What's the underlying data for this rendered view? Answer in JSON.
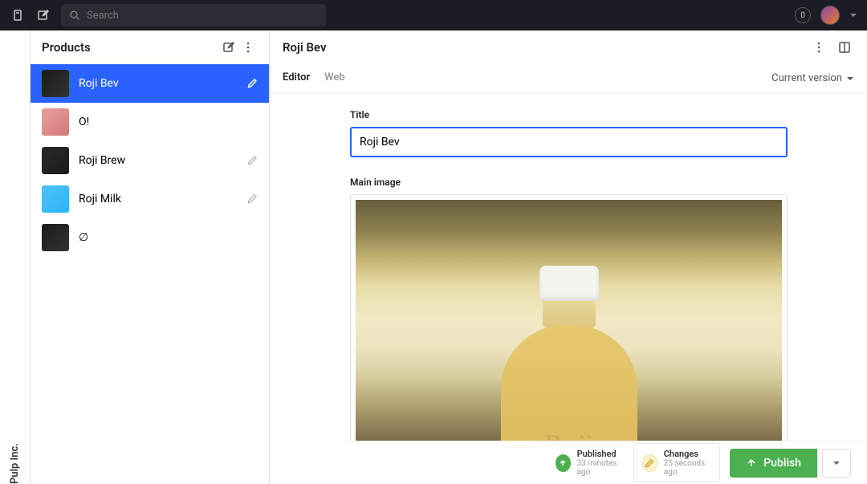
{
  "topbar": {
    "search_placeholder": "Search",
    "notification_count": "0"
  },
  "org": {
    "name": "Pulp Inc."
  },
  "left": {
    "title": "Products",
    "products": [
      {
        "name": "Roji Bev",
        "thumb_bg": "linear-gradient(135deg,#1a1a1a,#333)",
        "active": true
      },
      {
        "name": "O!",
        "thumb_bg": "linear-gradient(135deg,#e8a0a0,#d47878)"
      },
      {
        "name": "Roji Brew",
        "thumb_bg": "linear-gradient(135deg,#2a2a2a,#1a1a1a)"
      },
      {
        "name": "Roji Milk",
        "thumb_bg": "linear-gradient(135deg,#4fc3f7,#29b6f6)"
      },
      {
        "name": "∅",
        "thumb_bg": "linear-gradient(135deg,#1a1a1a,#333)"
      }
    ]
  },
  "doc": {
    "title": "Roji Bev",
    "tabs": [
      {
        "label": "Editor",
        "active": true
      },
      {
        "label": "Web",
        "active": false
      }
    ],
    "version_label": "Current version",
    "fields": {
      "title_label": "Title",
      "title_value": "Roji Bev",
      "image_label": "Main image"
    }
  },
  "footer": {
    "published": {
      "label": "Published",
      "time": "33 minutes ago"
    },
    "changes": {
      "label": "Changes",
      "time": "25 seconds ago"
    },
    "publish_button": "Publish"
  }
}
